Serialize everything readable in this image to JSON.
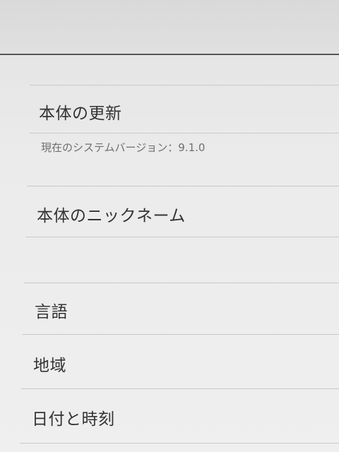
{
  "settings": {
    "items": [
      {
        "label": "本体の更新"
      },
      {
        "label": "本体のニックネーム"
      },
      {
        "label": "言語"
      },
      {
        "label": "地域"
      },
      {
        "label": "日付と時刻"
      }
    ],
    "system_version": {
      "label": "現在のシステムバージョン",
      "separator": "：",
      "value": "9.1.0"
    }
  }
}
